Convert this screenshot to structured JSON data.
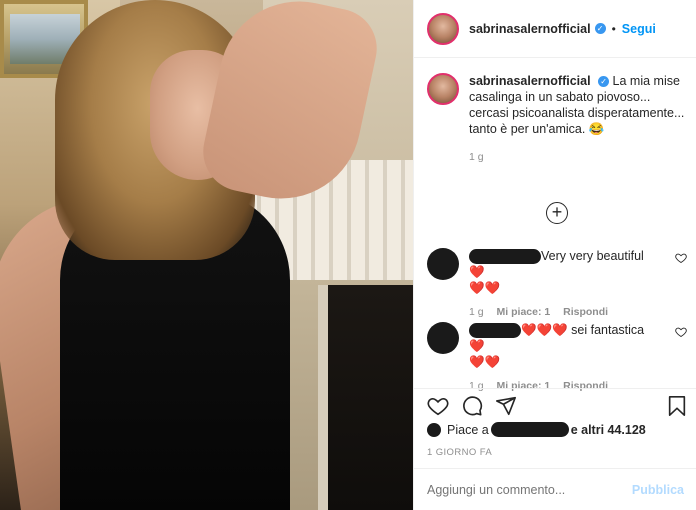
{
  "post": {
    "username": "sabrinasalernofficial",
    "follow_label": "Segui",
    "separator": "•",
    "caption": "La mia mise casalinga in un sabato piovoso... cercasi psicoanalista disperatamente... tanto è per un'amica. 😂",
    "caption_time": "1 g"
  },
  "comments": [
    {
      "text": "Very very beautiful ❤️",
      "line2": "❤️❤️",
      "time": "1 g",
      "likes_label": "Mi piace: 1",
      "reply_label": "Rispondi"
    },
    {
      "hearts": "❤️❤️❤️",
      "text": " sei fantastica ❤️",
      "line2": "❤️❤️",
      "time": "1 g",
      "likes_label": "Mi piace: 1",
      "reply_label": "Rispondi"
    }
  ],
  "likes": {
    "prefix": "Piace a",
    "suffix": "e altri 44.128"
  },
  "timestamp": "1 GIORNO FA",
  "composer": {
    "placeholder": "Aggiungi un commento...",
    "post_label": "Pubblica"
  },
  "icons": {
    "like": "heart-icon",
    "comment": "comment-icon",
    "share": "share-icon",
    "save": "bookmark-icon",
    "verified": "verified-badge-icon",
    "more_comments": "plus-circle-icon"
  },
  "colors": {
    "accent": "#0095f6",
    "heart": "#ed4956",
    "muted": "#8e8e8e"
  }
}
